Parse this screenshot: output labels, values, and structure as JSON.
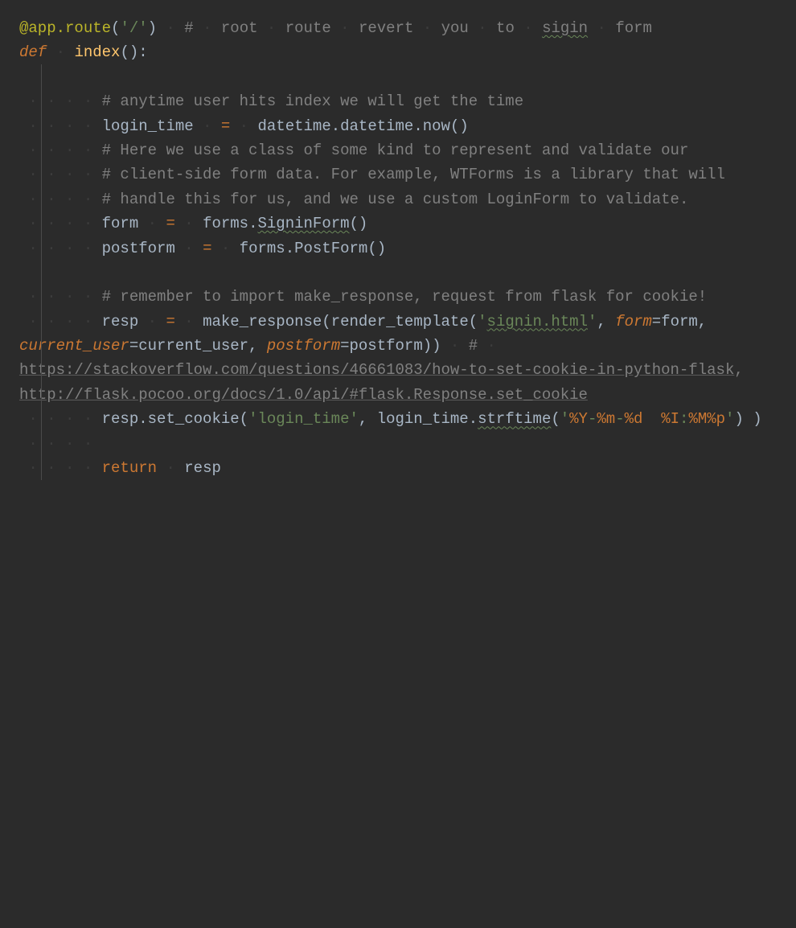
{
  "code": {
    "line1_decorator": "@app",
    "line1_dot": ".",
    "line1_route": "route",
    "line1_paren_open": "(",
    "line1_string": "'/'",
    "line1_paren_close": ")",
    "line1_comment_hash": "#",
    "line1_comment_1": "root",
    "line1_comment_2": "route",
    "line1_comment_3": "revert",
    "line1_comment_4": "you",
    "line1_comment_5": "to",
    "line1_comment_sigin": "sigin",
    "line1_comment_6": "form",
    "line2_def": "def",
    "line2_name": "index",
    "line2_parens": "():",
    "line3_comment": "# anytime user hits index we will get the time",
    "line4_var": "login_time",
    "line4_eq": "=",
    "line4_expr": "datetime.datetime.now()",
    "line5_comment": "# Here we use a class of some kind to represent and validate our",
    "line6_comment": "# client-side form data. For example, WTForms is a library that will",
    "line7_comment": "# handle this for us, and we use a custom LoginForm to validate.",
    "line8_var": "form",
    "line8_eq": "=",
    "line8_expr_pre": "forms.",
    "line8_expr_signin": "SigninForm",
    "line8_expr_post": "()",
    "line9_var": "postform",
    "line9_eq": "=",
    "line9_expr": "forms.PostForm()",
    "line10_comment": "# remember to import make_response, request from flask for cookie!",
    "line11_var": "resp",
    "line11_eq": "=",
    "line11_expr_pre": "make_response(render_template(",
    "line11_string": "'",
    "line11_string_signin": "signin.html",
    "line11_string_end": "'",
    "line11_comma": ", ",
    "line11_param1": "form",
    "line11_eq1": "=",
    "line11_val1": "form, ",
    "line11_param2": "current_user",
    "line11_eq2": "=",
    "line11_val2": "current_user, ",
    "line11_param3": "postform",
    "line11_eq3": "=",
    "line11_val3": "postform))",
    "line11_hash": "#",
    "line11_link1": "https://stackoverflow.com/questions/46661083/how-to-set-cookie-in-python-flask",
    "line11_comma2": ", ",
    "line11_link2": "http://flask.pocoo.org/docs/1.0/api/#flask.Response.set_cookie",
    "line12_pre": "resp.set_cookie(",
    "line12_str1": "'login_time'",
    "line12_mid": ", login_time.",
    "line12_strftime": "strftime",
    "line12_paren": "(",
    "line12_str2_q": "'",
    "line12_esc1": "%Y",
    "line12_dash1": "-",
    "line12_esc2": "%m",
    "line12_dash2": "-",
    "line12_esc3": "%d",
    "line12_space": "  ",
    "line12_esc4": "%I",
    "line12_colon": ":",
    "line12_esc5": "%M%p",
    "line12_str2_end": "'",
    "line12_close": ") )",
    "line13_return": "return",
    "line13_val": "resp"
  }
}
